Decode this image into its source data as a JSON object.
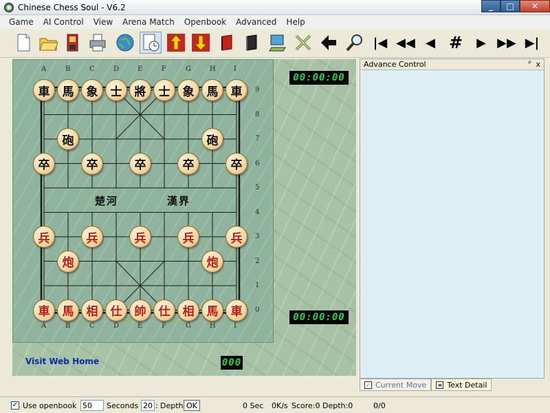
{
  "window": {
    "title": "Chinese Chess Soul - V6.2"
  },
  "window_buttons": {
    "minimize": "_",
    "maximize": "□",
    "close": "✕"
  },
  "menu": [
    "Game",
    "AI Control",
    "View",
    "Arena Match",
    "Openbook",
    "Advanced",
    "Help"
  ],
  "toolbar": {
    "icons": [
      "new-document-icon",
      "open-folder-icon",
      "save-disk-icon",
      "printer-icon",
      "globe-icon",
      "clock-icon",
      "swap-up-icon",
      "swap-down-icon",
      "red-book-icon",
      "black-book-icon",
      "computer-icon",
      "crossed-swords-icon",
      "back-arrow-icon",
      "magnifier-icon"
    ],
    "nav": [
      "|◀",
      "◀◀",
      "◀",
      "#",
      "▶",
      "▶▶",
      "▶|"
    ]
  },
  "board": {
    "files": [
      "A",
      "B",
      "C",
      "D",
      "E",
      "F",
      "G",
      "H",
      "I"
    ],
    "ranks": [
      "9",
      "8",
      "7",
      "6",
      "5",
      "4",
      "3",
      "2",
      "1",
      "0"
    ],
    "river_left": "楚河",
    "river_right": "漢界",
    "pieces": [
      {
        "file": 0,
        "rank": 9,
        "side": "black",
        "char": "車"
      },
      {
        "file": 1,
        "rank": 9,
        "side": "black",
        "char": "馬"
      },
      {
        "file": 2,
        "rank": 9,
        "side": "black",
        "char": "象"
      },
      {
        "file": 3,
        "rank": 9,
        "side": "black",
        "char": "士"
      },
      {
        "file": 4,
        "rank": 9,
        "side": "black",
        "char": "將"
      },
      {
        "file": 5,
        "rank": 9,
        "side": "black",
        "char": "士"
      },
      {
        "file": 6,
        "rank": 9,
        "side": "black",
        "char": "象"
      },
      {
        "file": 7,
        "rank": 9,
        "side": "black",
        "char": "馬"
      },
      {
        "file": 8,
        "rank": 9,
        "side": "black",
        "char": "車"
      },
      {
        "file": 1,
        "rank": 7,
        "side": "black",
        "char": "砲"
      },
      {
        "file": 7,
        "rank": 7,
        "side": "black",
        "char": "砲"
      },
      {
        "file": 0,
        "rank": 6,
        "side": "black",
        "char": "卒"
      },
      {
        "file": 2,
        "rank": 6,
        "side": "black",
        "char": "卒"
      },
      {
        "file": 4,
        "rank": 6,
        "side": "black",
        "char": "卒"
      },
      {
        "file": 6,
        "rank": 6,
        "side": "black",
        "char": "卒"
      },
      {
        "file": 8,
        "rank": 6,
        "side": "black",
        "char": "卒"
      },
      {
        "file": 0,
        "rank": 3,
        "side": "red",
        "char": "兵"
      },
      {
        "file": 2,
        "rank": 3,
        "side": "red",
        "char": "兵"
      },
      {
        "file": 4,
        "rank": 3,
        "side": "red",
        "char": "兵"
      },
      {
        "file": 6,
        "rank": 3,
        "side": "red",
        "char": "兵"
      },
      {
        "file": 8,
        "rank": 3,
        "side": "red",
        "char": "兵"
      },
      {
        "file": 1,
        "rank": 2,
        "side": "red",
        "char": "炮"
      },
      {
        "file": 7,
        "rank": 2,
        "side": "red",
        "char": "炮"
      },
      {
        "file": 0,
        "rank": 0,
        "side": "red",
        "char": "車"
      },
      {
        "file": 1,
        "rank": 0,
        "side": "red",
        "char": "馬"
      },
      {
        "file": 2,
        "rank": 0,
        "side": "red",
        "char": "相"
      },
      {
        "file": 3,
        "rank": 0,
        "side": "red",
        "char": "仕"
      },
      {
        "file": 4,
        "rank": 0,
        "side": "red",
        "char": "帥"
      },
      {
        "file": 5,
        "rank": 0,
        "side": "red",
        "char": "仕"
      },
      {
        "file": 6,
        "rank": 0,
        "side": "red",
        "char": "相"
      },
      {
        "file": 7,
        "rank": 0,
        "side": "red",
        "char": "馬"
      },
      {
        "file": 8,
        "rank": 0,
        "side": "red",
        "char": "車"
      }
    ]
  },
  "timers": {
    "top": "00:00:00",
    "bottom": "00:00:00",
    "counter": "000"
  },
  "web_link": "Visit Web Home",
  "panel": {
    "title": "Advance Control",
    "pin": "ᵖ",
    "close": "x"
  },
  "tabs": [
    "Current Move",
    "Text Detail"
  ],
  "status": {
    "use_openbook_checked": "✓",
    "use_openbook_label": "Use openbook",
    "seconds_value": "50",
    "seconds_label": "Seconds",
    "depth_value": "20",
    "depth_label": "Depth",
    "ok": "OK",
    "time": "0 Sec",
    "speed": "0K/s",
    "score": "Score:0",
    "depth": "Depth:0",
    "progress": "0/0"
  },
  "colors": {
    "red_piece": "#c41a14",
    "black_piece": "#111111",
    "lcd_green": "#1fd64a",
    "link_blue": "#0b2ca8"
  }
}
